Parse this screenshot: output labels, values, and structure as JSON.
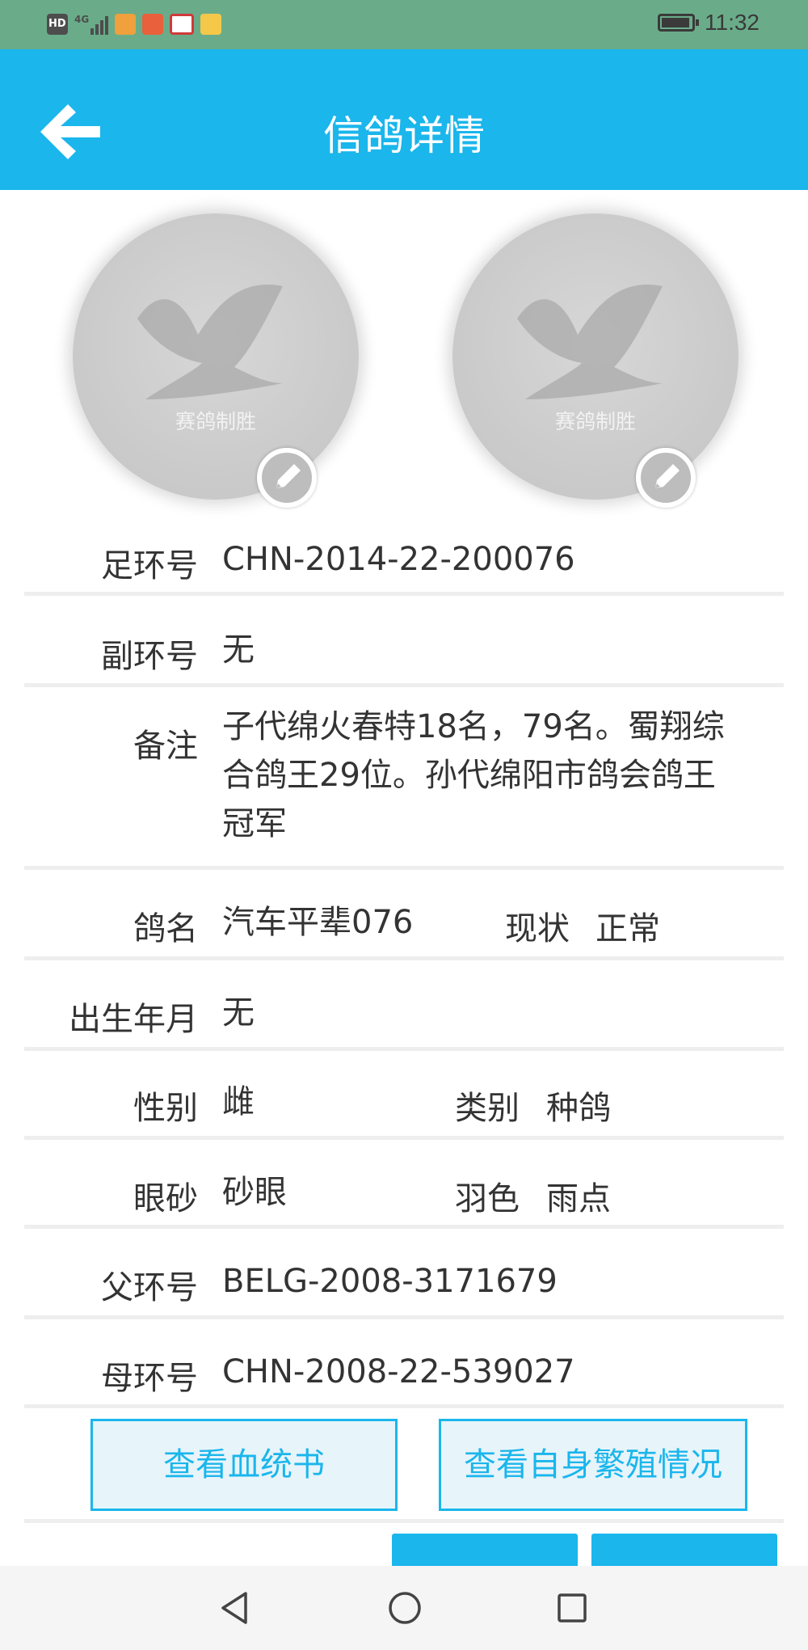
{
  "status_bar": {
    "network_label": "HD",
    "signal_label": "4G",
    "time": "11:32"
  },
  "header": {
    "title": "信鸽详情"
  },
  "photos": [
    {
      "watermark": "赛鸽制胜"
    },
    {
      "watermark": "赛鸽制胜"
    }
  ],
  "details": {
    "ring": {
      "label": "足环号",
      "value": "CHN-2014-22-200076"
    },
    "secondary_ring": {
      "label": "副环号",
      "value": "无"
    },
    "note": {
      "label": "备注",
      "line1": "子代绵火春特18名，79名。蜀翔综",
      "line2": "合鸽王29位。孙代绵阳市鸽会鸽王",
      "line3": "冠军"
    },
    "name": {
      "label": "鸽名",
      "value": "汽车平辈076"
    },
    "status": {
      "label": "现状",
      "value": "正常"
    },
    "birth": {
      "label": "出生年月",
      "value": "无"
    },
    "sex": {
      "label": "性别",
      "value": "雌"
    },
    "category": {
      "label": "类别",
      "value": "种鸽"
    },
    "eye": {
      "label": "眼砂",
      "value": "砂眼"
    },
    "feather": {
      "label": "羽色",
      "value": "雨点"
    },
    "father_ring": {
      "label": "父环号",
      "value": "BELG-2008-3171679"
    },
    "mother_ring": {
      "label": "母环号",
      "value": "CHN-2008-22-539027"
    }
  },
  "actions": {
    "pedigree_button": "查看血统书",
    "breeding_button": "查看自身繁殖情况"
  },
  "colors": {
    "status_bar": "#6aac8a",
    "accent": "#1ab6ec",
    "divider": "#eeeeee"
  }
}
